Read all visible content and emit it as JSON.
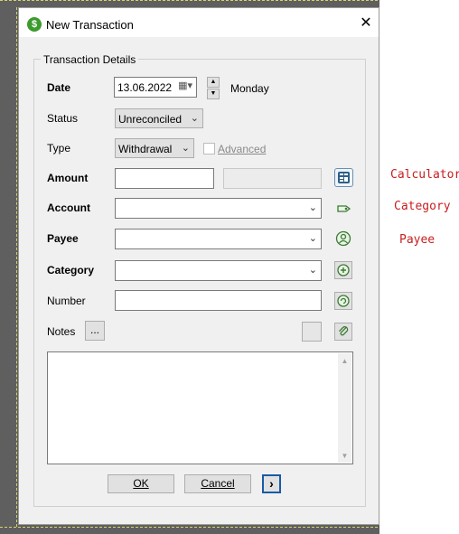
{
  "window": {
    "title": "New Transaction",
    "close_glyph": "✕",
    "app_icon_glyph": "$"
  },
  "group": {
    "title": "Transaction Details"
  },
  "fields": {
    "date": {
      "label": "Date",
      "value": "13.06.2022",
      "weekday": "Monday"
    },
    "status": {
      "label": "Status",
      "value": "Unreconciled"
    },
    "type": {
      "label": "Type",
      "value": "Withdrawal",
      "advanced_label": "Advanced"
    },
    "amount": {
      "label": "Amount",
      "value": "",
      "second_value": ""
    },
    "account": {
      "label": "Account",
      "value": ""
    },
    "payee": {
      "label": "Payee",
      "value": ""
    },
    "category": {
      "label": "Category",
      "value": ""
    },
    "number": {
      "label": "Number",
      "value": ""
    },
    "notes": {
      "label": "Notes",
      "ellipsis": "...",
      "value": ""
    }
  },
  "buttons": {
    "ok": "OK",
    "cancel": "Cancel",
    "next": "›"
  },
  "annotations": {
    "calculator": "Calculator",
    "category": "Category",
    "payee": "Payee"
  },
  "icons": {
    "calculator": "calculator-icon",
    "account": "tag-icon",
    "payee": "user-icon",
    "category": "add-icon",
    "number": "refresh-icon",
    "attach": "paperclip-icon"
  },
  "colors": {
    "accent": "#3c9a2e",
    "note_red": "#c81e1e"
  }
}
